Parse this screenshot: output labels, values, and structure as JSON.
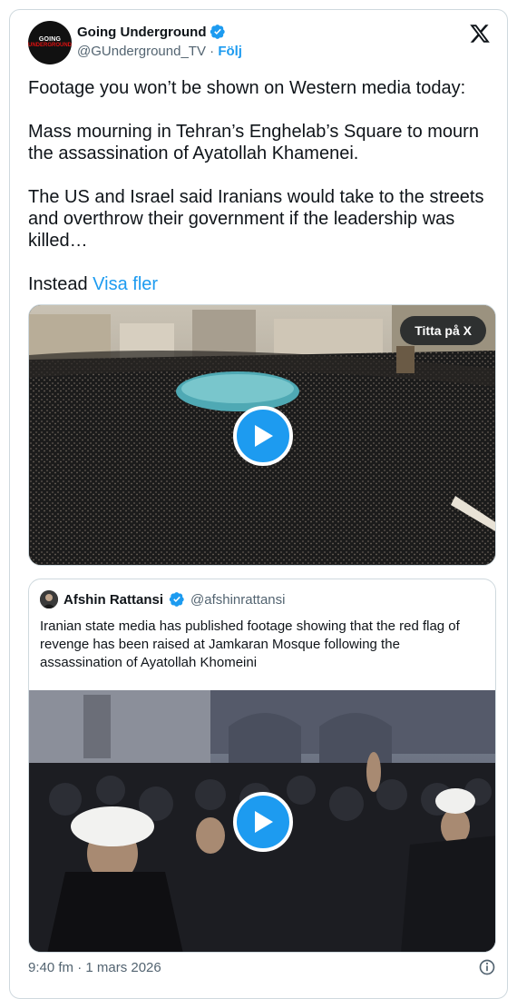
{
  "author": {
    "avatar_line1": "GOING",
    "avatar_line2": "UNDERGROUND",
    "display_name": "Going Underground",
    "handle": "@GUnderground_TV",
    "separator": " · ",
    "follow_label": "Följ"
  },
  "tweet": {
    "para1": "Footage you won’t be shown on Western media today:",
    "para2": "Mass mourning in Tehran’s Enghelab’s Square to mourn the assassination of Ayatollah Khamenei.",
    "para3": "The US and Israel said Iranians would take to the streets and overthrow their government if the leadership was killed…",
    "para4": "Instead ",
    "show_more": "Visa fler"
  },
  "media": {
    "watch_on_x": "Titta på X"
  },
  "quote": {
    "display_name": "Afshin Rattansi",
    "handle": "@afshinrattansi",
    "text": "Iranian state media has published footage showing that the red flag of revenge has been raised at Jamkaran Mosque following the assassination of Ayatollah Khomeini"
  },
  "footer": {
    "timestamp": "9:40 fm · 1 mars 2026"
  },
  "colors": {
    "accent": "#1d9bf0",
    "secondary_text": "#536471",
    "border": "#cfd9de"
  },
  "icons": [
    "verified-badge-icon",
    "x-logo-icon",
    "play-icon",
    "info-icon"
  ]
}
